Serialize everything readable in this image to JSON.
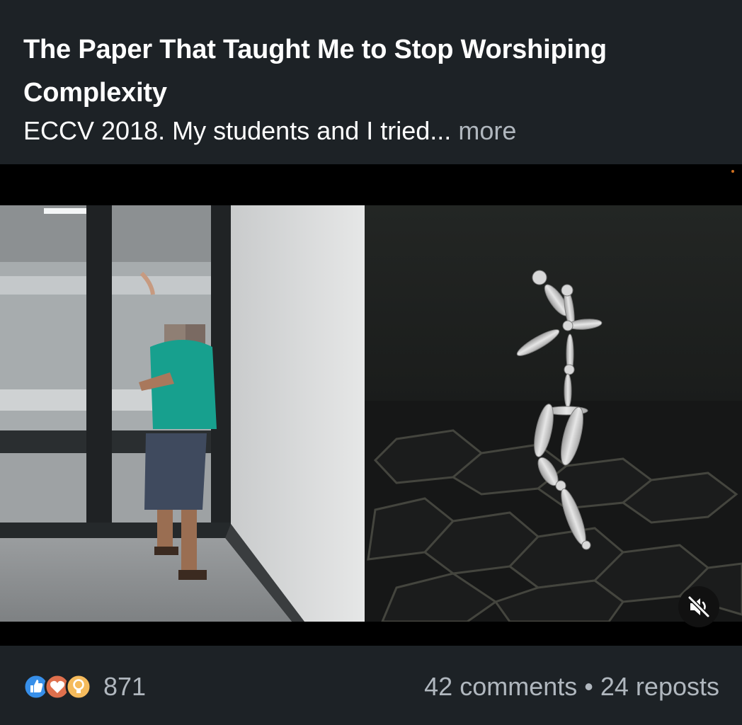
{
  "post": {
    "title": "The Paper That Taught Me to Stop Worshiping Complexity",
    "body": "ECCV 2018. My students and I tried...",
    "more_label": "more"
  },
  "video": {
    "muted": true,
    "icon": "speaker-muted-icon"
  },
  "social": {
    "reaction_icons": [
      "like-icon",
      "love-icon",
      "insightful-icon"
    ],
    "reaction_count": "871",
    "comments": "42 comments",
    "separator": "•",
    "reposts": "24 reposts"
  },
  "colors": {
    "background": "#1d2226",
    "text": "#ffffff",
    "muted_text": "#b0b7be",
    "like_blue": "#378fe9",
    "love_red": "#df704d",
    "insight_yellow": "#f5bb5c"
  }
}
